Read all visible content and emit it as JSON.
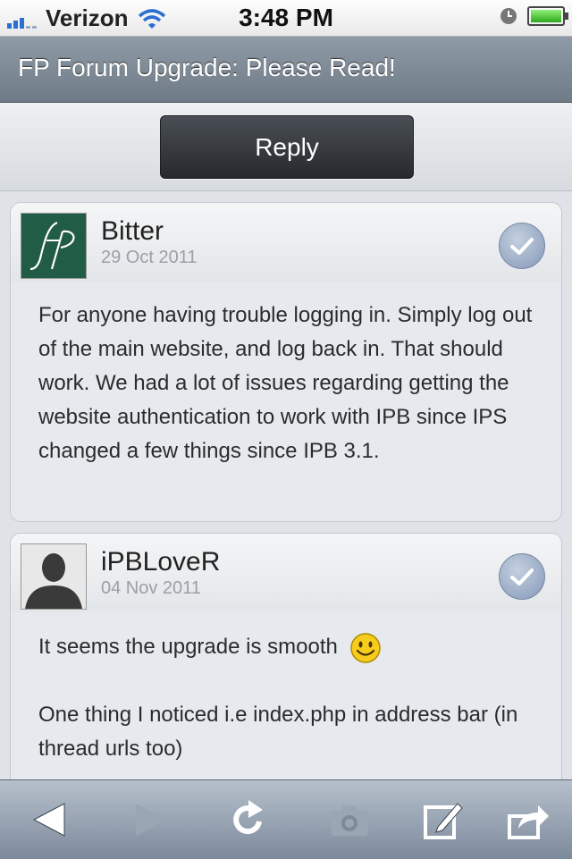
{
  "status": {
    "carrier": "Verizon",
    "time": "3:48 PM",
    "battery_level": 0.9
  },
  "title": "FP Forum Upgrade: Please Read!",
  "reply_label": "Reply",
  "posts": [
    {
      "author": "Bitter",
      "date": "29 Oct 2011",
      "avatar": "fp-logo",
      "paragraphs": [
        "For anyone having trouble logging in. Simply log out of the main website, and log back in. That should work. We had a lot of issues regarding getting the website authentication to work with IPB since IPS changed a few things since IPB 3.1."
      ]
    },
    {
      "author": "iPBLoveR",
      "date": "04 Nov 2011",
      "avatar": "default-person",
      "paragraphs": [
        "It seems the upgrade is smooth",
        "One thing I noticed i.e index.php in address bar (in thread urls too)"
      ]
    }
  ],
  "toolbar": [
    "back-icon",
    "forward-icon",
    "refresh-icon",
    "camera-icon",
    "compose-icon",
    "share-icon"
  ],
  "colors": {
    "title_bar": "#7d8995",
    "toolbar": "#8c98a8",
    "check": "#8a9cba"
  }
}
